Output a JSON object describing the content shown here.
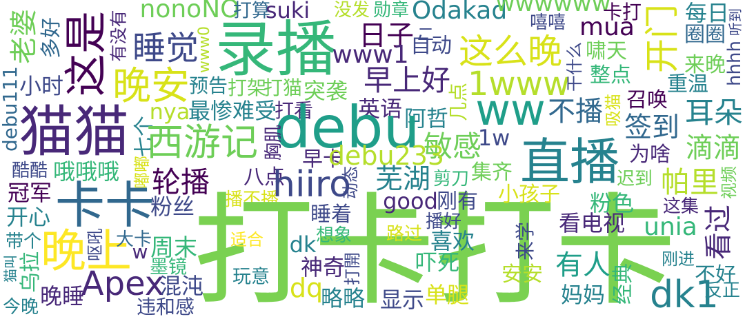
{
  "type": "word-cloud",
  "words": [
    {
      "text": "老婆",
      "color": "#6ece58"
    },
    {
      "text": "多好",
      "color": "#31688e"
    },
    {
      "text": "这是",
      "color": "#440154"
    },
    {
      "text": "有没有",
      "color": "#482878"
    },
    {
      "text": "睡觉",
      "color": "#3e4989"
    },
    {
      "text": "nonoNO",
      "color": "#6ece58"
    },
    {
      "text": "打算",
      "color": "#31688e"
    },
    {
      "text": "suki",
      "color": "#482878"
    },
    {
      "text": "录播",
      "color": "#35b779"
    },
    {
      "text": "www0",
      "color": "#b5de2b"
    },
    {
      "text": "晚安",
      "color": "#d8e219"
    },
    {
      "text": "小时",
      "color": "#3e4989"
    },
    {
      "text": "debu111",
      "color": "#31688e"
    },
    {
      "text": "预告",
      "color": "#26828e"
    },
    {
      "text": "打架",
      "color": "#6ece58"
    },
    {
      "text": "打猫",
      "color": "#6ece58"
    },
    {
      "text": "突袭",
      "color": "#6ece58"
    },
    {
      "text": "猫猫",
      "color": "#482878"
    },
    {
      "text": "七个",
      "color": "#26828e"
    },
    {
      "text": "nya",
      "color": "#b5de2b"
    },
    {
      "text": "最惨难受",
      "color": "#26828e"
    },
    {
      "text": "打看",
      "color": "#482878"
    },
    {
      "text": "西游记",
      "color": "#6ece58"
    },
    {
      "text": "酷酷",
      "color": "#3e4989"
    },
    {
      "text": "哦哦哦",
      "color": "#35b779"
    },
    {
      "text": "嘟嘟",
      "color": "#d8e219"
    },
    {
      "text": "轮播",
      "color": "#440154"
    },
    {
      "text": "冠军",
      "color": "#440154"
    },
    {
      "text": "卡卡",
      "color": "#31688e"
    },
    {
      "text": "粉丝",
      "color": "#3e4989"
    },
    {
      "text": "开心",
      "color": "#26828e"
    },
    {
      "text": "播不播",
      "color": "#d8e219"
    },
    {
      "text": "打卡打卡",
      "color": "#7ad151"
    },
    {
      "text": "带个",
      "color": "#26828e"
    },
    {
      "text": "晚上",
      "color": "#fde725"
    },
    {
      "text": "呕吼",
      "color": "#3e4989"
    },
    {
      "text": "大卡",
      "color": "#31688e"
    },
    {
      "text": "周末",
      "color": "#35b779"
    },
    {
      "text": "适合",
      "color": "#fde725"
    },
    {
      "text": "w",
      "color": "#482878"
    },
    {
      "text": "乌拉",
      "color": "#35b779"
    },
    {
      "text": "猫叫",
      "color": "#26828e"
    },
    {
      "text": "墨镜",
      "color": "#35b779"
    },
    {
      "text": "玩意",
      "color": "#26828e"
    },
    {
      "text": "Apex",
      "color": "#482878"
    },
    {
      "text": "混沌",
      "color": "#3e4989"
    },
    {
      "text": "晚睡",
      "color": "#482878"
    },
    {
      "text": "今晚",
      "color": "#26828e"
    },
    {
      "text": "违和感",
      "color": "#3e4989"
    },
    {
      "text": "没发",
      "color": "#b5de2b"
    },
    {
      "text": "勋章",
      "color": "#35b779"
    },
    {
      "text": "Odakad",
      "color": "#26828e"
    },
    {
      "text": "日子",
      "color": "#440154"
    },
    {
      "text": "二",
      "color": "#3e4989"
    },
    {
      "text": "自动",
      "color": "#3e4989"
    },
    {
      "text": "www1",
      "color": "#482878"
    },
    {
      "text": "这么晚",
      "color": "#d8e219"
    },
    {
      "text": "早上好",
      "color": "#482878"
    },
    {
      "text": "1www",
      "color": "#b5de2b"
    },
    {
      "text": "几点",
      "color": "#b5de2b"
    },
    {
      "text": "英语",
      "color": "#482878"
    },
    {
      "text": "阿哲",
      "color": "#26828e"
    },
    {
      "text": "debu",
      "color": "#1f9e89"
    },
    {
      "text": "胸肌",
      "color": "#482878"
    },
    {
      "text": "ww",
      "color": "#1f9e89"
    },
    {
      "text": "敏感",
      "color": "#6ece58"
    },
    {
      "text": "1w",
      "color": "#3e4989"
    },
    {
      "text": "早卡",
      "color": "#482878"
    },
    {
      "text": "debu233",
      "color": "#b5de2b"
    },
    {
      "text": "动态",
      "color": "#3e4989"
    },
    {
      "text": "芜湖",
      "color": "#26828e"
    },
    {
      "text": "剪刀",
      "color": "#35b779"
    },
    {
      "text": "集齐",
      "color": "#6ece58"
    },
    {
      "text": "八点",
      "color": "#482878"
    },
    {
      "text": "hiiro",
      "color": "#3e4989"
    },
    {
      "text": "good",
      "color": "#482878"
    },
    {
      "text": "刚有",
      "color": "#3e4989"
    },
    {
      "text": "睡着",
      "color": "#3e4989"
    },
    {
      "text": "播好",
      "color": "#3e4989"
    },
    {
      "text": "想象",
      "color": "#35b779"
    },
    {
      "text": "路过",
      "color": "#d8e219"
    },
    {
      "text": "喜欢",
      "color": "#26828e"
    },
    {
      "text": "dk",
      "color": "#26828e"
    },
    {
      "text": "神奇",
      "color": "#482878"
    },
    {
      "text": "打開",
      "color": "#3e4989"
    },
    {
      "text": "吓死",
      "color": "#35b779"
    },
    {
      "text": "dq",
      "color": "#d8e219"
    },
    {
      "text": "略略",
      "color": "#26828e"
    },
    {
      "text": "显示",
      "color": "#3e4989"
    },
    {
      "text": "单腿",
      "color": "#d8e219"
    },
    {
      "text": "wwwwww",
      "color": "#6ece58"
    },
    {
      "text": "卡打",
      "color": "#440154"
    },
    {
      "text": "开门",
      "color": "#d8e219"
    },
    {
      "text": "每日",
      "color": "#26828e"
    },
    {
      "text": "听到",
      "color": "#3e4989"
    },
    {
      "text": "圈圈",
      "color": "#31688e"
    },
    {
      "text": "嘻嘻",
      "color": "#3e4989"
    },
    {
      "text": "mua",
      "color": "#440154"
    },
    {
      "text": "干什么",
      "color": "#3e4989"
    },
    {
      "text": "啸天",
      "color": "#6ece58"
    },
    {
      "text": "来晚",
      "color": "#6ece58"
    },
    {
      "text": "hhhh",
      "color": "#3e4989"
    },
    {
      "text": "整点",
      "color": "#35b779"
    },
    {
      "text": "重温",
      "color": "#26828e"
    },
    {
      "text": "召唤",
      "color": "#440154"
    },
    {
      "text": "吸猫",
      "color": "#d8e219"
    },
    {
      "text": "不播",
      "color": "#31688e"
    },
    {
      "text": "耳朵",
      "color": "#26828e"
    },
    {
      "text": "签到",
      "color": "#31688e"
    },
    {
      "text": "直播",
      "color": "#26828e"
    },
    {
      "text": "为啥",
      "color": "#482878"
    },
    {
      "text": "滴滴",
      "color": "#6ece58"
    },
    {
      "text": "迟到",
      "color": "#6ece58"
    },
    {
      "text": "视频",
      "color": "#6ece58"
    },
    {
      "text": "帕里",
      "color": "#b5de2b"
    },
    {
      "text": "小孩子",
      "color": "#d8e219"
    },
    {
      "text": "粉色",
      "color": "#35b779"
    },
    {
      "text": "这集",
      "color": "#482878"
    },
    {
      "text": "看电视",
      "color": "#482878"
    },
    {
      "text": "看过",
      "color": "#482878"
    },
    {
      "text": "来学",
      "color": "#3e4989"
    },
    {
      "text": "unia",
      "color": "#35b779"
    },
    {
      "text": "刚进",
      "color": "#26828e"
    },
    {
      "text": "有人",
      "color": "#1f9e89"
    },
    {
      "text": "安安",
      "color": "#b5de2b"
    },
    {
      "text": "经典",
      "color": "#35b779"
    },
    {
      "text": "不好",
      "color": "#26828e"
    },
    {
      "text": "妈妈",
      "color": "#26828e"
    },
    {
      "text": "dk1",
      "color": "#26828e"
    },
    {
      "text": "反正",
      "color": "#26828e"
    }
  ]
}
